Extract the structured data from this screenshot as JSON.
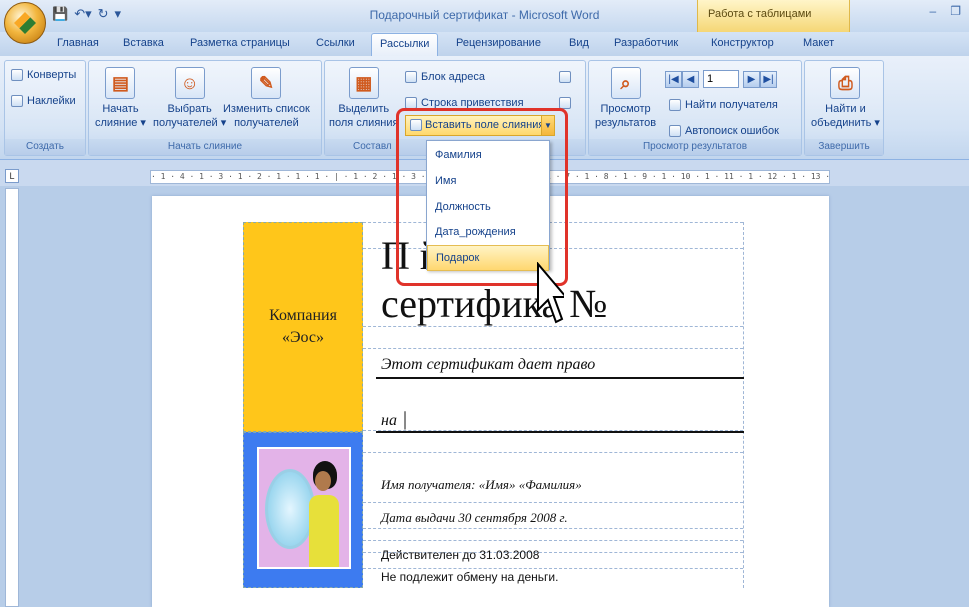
{
  "window": {
    "title": "Подарочный сертификат - Microsoft Word",
    "context_tab": "Работа с таблицами",
    "minimize": "–",
    "restore": "❐"
  },
  "tabs": [
    "Главная",
    "Вставка",
    "Разметка страницы",
    "Ссылки",
    "Рассылки",
    "Рецензирование",
    "Вид",
    "Разработчик",
    "Конструктор",
    "Макет"
  ],
  "active_tab": "Рассылки",
  "ribbon": {
    "create": {
      "label": "Создать",
      "envelopes": "Конверты",
      "labels": "Наклейки"
    },
    "start": {
      "label": "Начать слияние",
      "start_merge": "Начать\nслияние ▾",
      "select_recipients": "Выбрать\nполучателей ▾",
      "edit_list": "Изменить список\nполучателей"
    },
    "compose": {
      "label": "Составл",
      "highlight": "Выделить\nполя слияния",
      "address_block": "Блок адреса",
      "greeting_line": "Строка приветствия"
    },
    "preview": {
      "label": "Просмотр результатов",
      "preview_results": "Просмотр\nрезультатов",
      "record_value": "1",
      "find_recipient": "Найти получателя",
      "auto_check": "Автопоиск ошибок"
    },
    "finish": {
      "label": "Завершить",
      "finish_merge": "Найти и\nобъединить ▾"
    }
  },
  "dropdown": {
    "button": "Вставить поле слияния",
    "items": [
      "Фамилия",
      "Имя",
      "Должность",
      "Дата_рождения",
      "Подарок"
    ],
    "highlighted": "Подарок"
  },
  "ruler": {
    "marks": "· 1 · 4 · 1 · 3 · 1 · 2 · 1 · 1 · 1 · | · 1 · 2 · 1 · 3 · 1 · 4 · 1 · 5 · 1 · 6 · 1 · 7 · 1 · 8 · 1 · 9 · 1 · 10 · 1 · 11 · 1 · 12 · 1 · 13 · 1 · 14 · 1 · 15 · 1 · 16 ·"
  },
  "certificate": {
    "company": "Компания\n«Эос»",
    "title_line1": "П          й",
    "title_line2": "сертифика  №",
    "right_text": "Этот сертификат дает право",
    "na": "на",
    "recipient": "Имя получателя:  «Имя» «Фамилия»",
    "issue_date": "Дата выдачи 30 сентября  2008 г.",
    "valid_until": "Действителен до 31.03.2008",
    "no_exchange": "Не подлежит обмену на деньги."
  }
}
